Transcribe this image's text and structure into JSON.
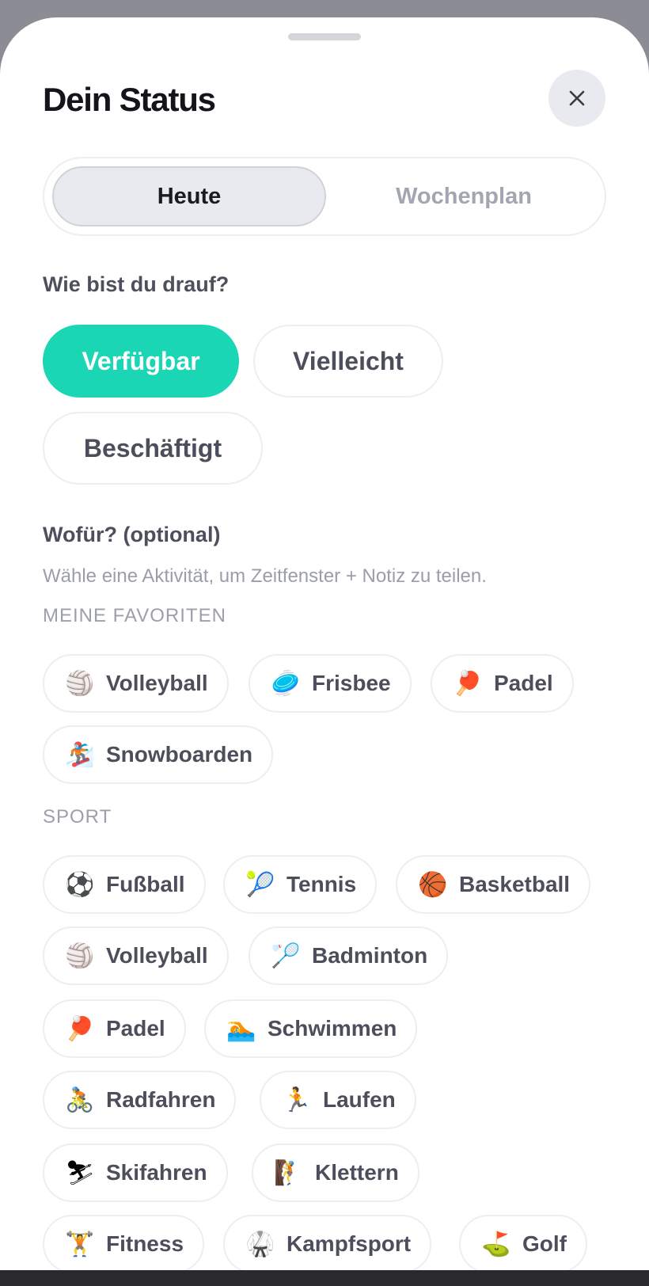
{
  "header": {
    "title": "Dein Status",
    "close_icon": "close-icon"
  },
  "tabs": [
    {
      "label": "Heute",
      "active": true
    },
    {
      "label": "Wochenplan",
      "active": false
    }
  ],
  "mood": {
    "question": "Wie bist du drauf?",
    "options": [
      {
        "label": "Verfügbar",
        "selected": true,
        "color": "#1ad6b4"
      },
      {
        "label": "Vielleicht",
        "selected": false
      },
      {
        "label": "Beschäftigt",
        "selected": false
      }
    ]
  },
  "activity": {
    "question": "Wofür? (optional)",
    "hint": "Wähle eine Aktivität, um Zeitfenster + Notiz zu teilen.",
    "favorites_caption": "MEINE FAVORITEN",
    "favorites": [
      {
        "label": "Volleyball",
        "emoji": "🏐",
        "icon": "volleyball-icon"
      },
      {
        "label": "Frisbee",
        "emoji": "🥏",
        "icon": "frisbee-icon"
      },
      {
        "label": "Padel",
        "emoji": "🏓",
        "icon": "padel-icon"
      },
      {
        "label": "Snowboarden",
        "emoji": "🏂",
        "icon": "snowboard-icon"
      }
    ],
    "sport_caption": "SPORT",
    "sport": [
      {
        "label": "Fußball",
        "emoji": "⚽",
        "icon": "soccer-ball-icon"
      },
      {
        "label": "Tennis",
        "emoji": "🎾",
        "icon": "tennis-icon"
      },
      {
        "label": "Basketball",
        "emoji": "🏀",
        "icon": "basketball-icon"
      },
      {
        "label": "Volleyball",
        "emoji": "🏐",
        "icon": "volleyball-icon"
      },
      {
        "label": "Badminton",
        "emoji": "🏸",
        "icon": "badminton-icon"
      },
      {
        "label": "Padel",
        "emoji": "🏓",
        "icon": "padel-icon"
      },
      {
        "label": "Schwimmen",
        "emoji": "🏊",
        "icon": "swimmer-icon"
      },
      {
        "label": "Radfahren",
        "emoji": "🚴",
        "icon": "cyclist-icon"
      },
      {
        "label": "Laufen",
        "emoji": "🏃",
        "icon": "runner-icon"
      },
      {
        "label": "Skifahren",
        "emoji": "⛷",
        "icon": "skier-icon"
      },
      {
        "label": "Klettern",
        "emoji": "🧗",
        "icon": "climber-icon"
      },
      {
        "label": "Fitness",
        "emoji": "🏋",
        "icon": "weightlifter-icon"
      },
      {
        "label": "Kampfsport",
        "emoji": "🥋",
        "icon": "martial-arts-icon"
      },
      {
        "label": "Golf",
        "emoji": "⛳",
        "icon": "golf-flag-icon"
      }
    ]
  }
}
